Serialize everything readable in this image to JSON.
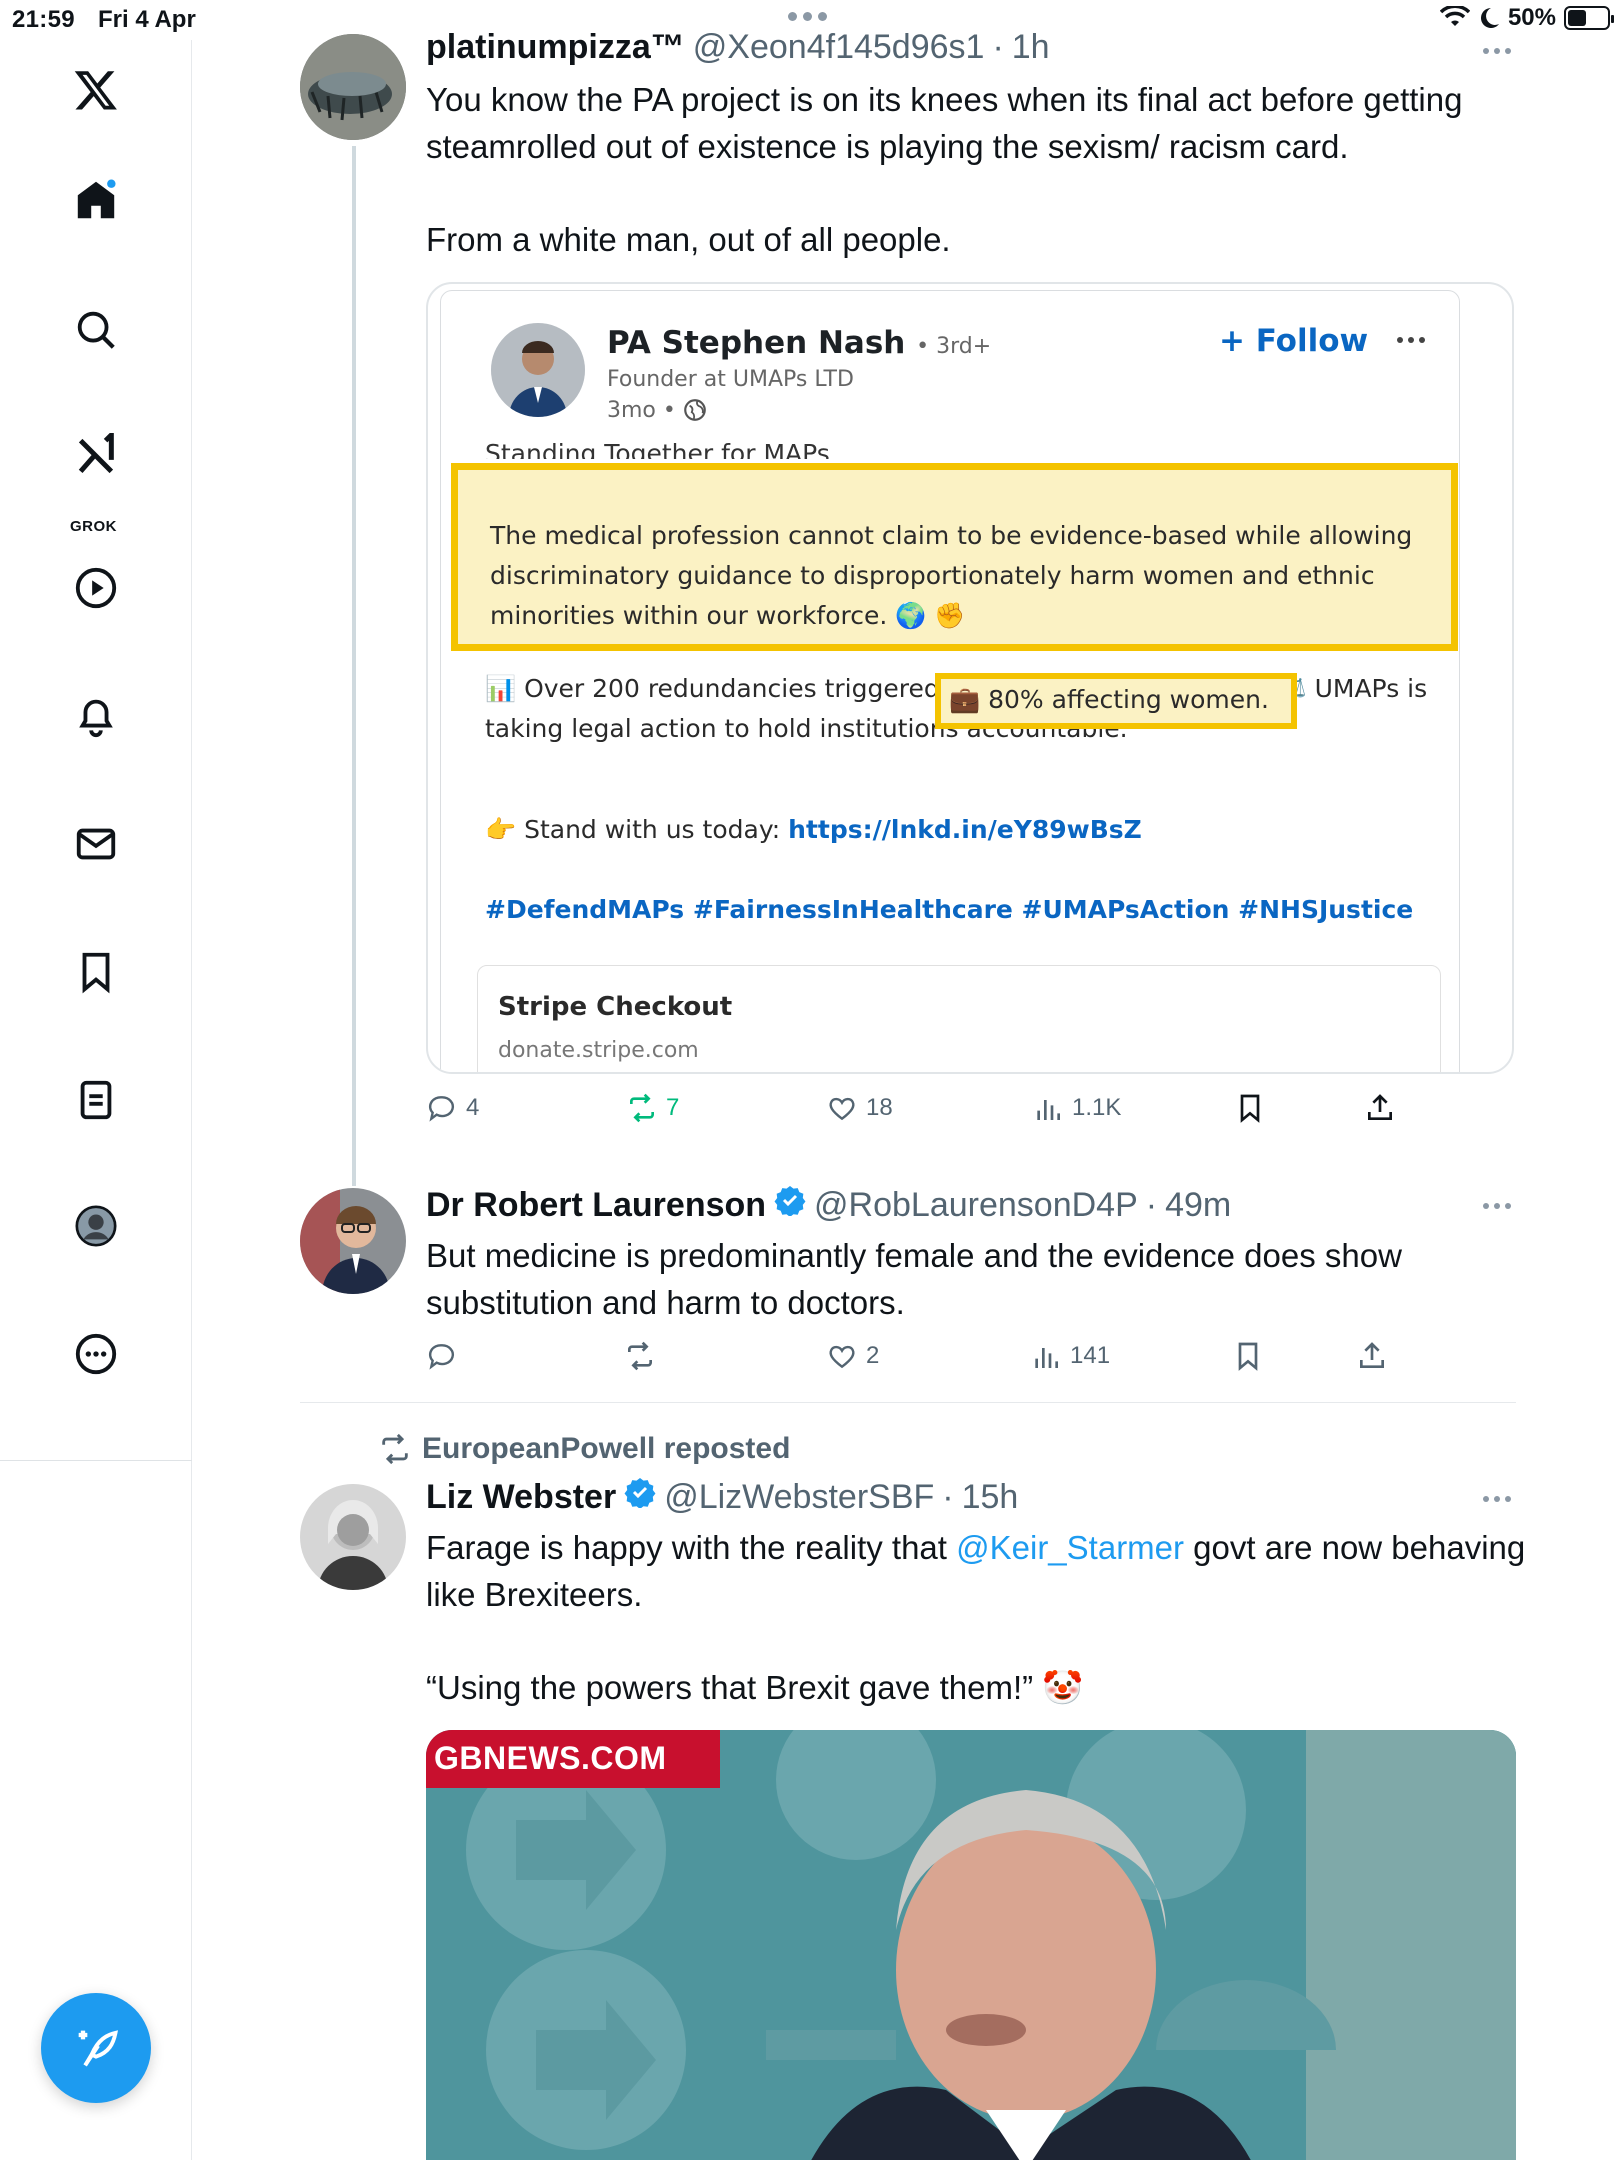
{
  "status_bar": {
    "time": "21:59",
    "date": "Fri 4 Apr",
    "battery": "50%",
    "battery_level": 0.5
  },
  "sidebar": {
    "grok_label": "GROK",
    "items": [
      "x-logo",
      "home-icon",
      "search-icon",
      "grok-icon",
      "video-icon",
      "notifications-icon",
      "messages-icon",
      "bookmarks-icon",
      "lists-icon",
      "profile-icon",
      "more-icon"
    ]
  },
  "tweets": [
    {
      "name": "platinumpizza™",
      "handle": "@Xeon4f145d96s1",
      "time": "1h",
      "text_1": "You know the PA project is on its knees when its final act before getting steamrolled out of existence is playing the sexism/ racism card.",
      "text_2": "From a white man, out of all people.",
      "embed": {
        "name": "PA Stephen Nash",
        "degree": "• 3rd+",
        "subtitle": "Founder at UMAPs LTD",
        "time": "3mo •",
        "follow": "+ Follow",
        "cut_line": "Standing Together for MAPs",
        "highlight_text": "The medical profession cannot claim to be evidence-based while allowing discriminatory guidance to disproportionately harm women and ethnic minorities within our workforce. 🌍 ✊",
        "body": "📊 Over 200 redundancies triggered 💼 80% affecting women. ⚖️ UMAPs is taking legal action to hold institutions accountable.",
        "highlight_inline": "💼 80% affecting women.",
        "stand_prefix": "👉 Stand with us today: ",
        "stand_link": "https://lnkd.in/eY89wBsZ",
        "hashtags": "#DefendMAPs #FairnessInHealthcare #UMAPsAction #NHSJustice",
        "preview_title": "Stripe Checkout",
        "preview_url": "donate.stripe.com"
      },
      "replies": "4",
      "reposts": "7",
      "likes": "18",
      "views": "1.1K"
    },
    {
      "name": "Dr Robert Laurenson",
      "handle": "@RobLaurensonD4P",
      "time": "49m",
      "text": "But medicine is predominantly female and the evidence does show substitution and harm to doctors.",
      "replies": "",
      "reposts": "",
      "likes": "2",
      "views": "141"
    },
    {
      "reposted_by": "EuropeanPowell reposted",
      "name": "Liz Webster",
      "handle": "@LizWebsterSBF",
      "time": "15h",
      "text_a": "Farage is happy with the reality that ",
      "mention": "@Keir_Starmer",
      "text_b": " govt are now behaving like Brexiteers.",
      "text_2": "“Using the powers that Brexit gave them!” 🤡",
      "media_badge": "GBNEWS.COM"
    }
  ],
  "colors": {
    "accent": "#1d9bf0",
    "repost_green": "#00ba7c",
    "highlight": "#f4c300",
    "linkedin_blue": "#0a66c2"
  }
}
